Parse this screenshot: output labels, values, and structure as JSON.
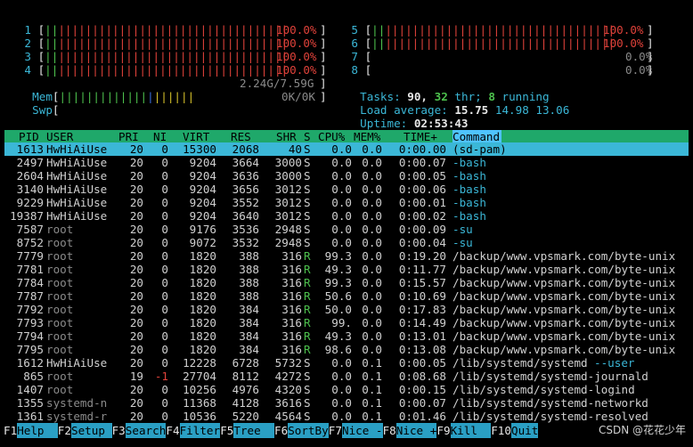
{
  "cpus_left": [
    {
      "num": "1",
      "bar_green": "||",
      "bar_red": "||||||||||||||||||||||||||||||||||",
      "pct": "100.0%"
    },
    {
      "num": "2",
      "bar_green": "||",
      "bar_red": "||||||||||||||||||||||||||||||||||",
      "pct": "100.0%"
    },
    {
      "num": "3",
      "bar_green": "||",
      "bar_red": "||||||||||||||||||||||||||||||||||",
      "pct": "100.0%"
    },
    {
      "num": "4",
      "bar_green": "||",
      "bar_red": "||||||||||||||||||||||||||||||||||",
      "pct": "100.0%"
    }
  ],
  "cpus_right": [
    {
      "num": "5",
      "bar_green": "||",
      "bar_red": "||||||||||||||||||||||||||||||||||",
      "pct": "100.0%"
    },
    {
      "num": "6",
      "bar_green": "||",
      "bar_red": "||||||||||||||||||||||||||||||||||",
      "pct": "100.0%"
    },
    {
      "num": "7",
      "bar_green": "",
      "bar_red": "",
      "pct": "0.0%"
    },
    {
      "num": "8",
      "bar_green": "",
      "bar_red": "",
      "pct": "0.0%"
    }
  ],
  "mem": {
    "label": "Mem",
    "bar_green": "|||||||||||||",
    "bar_blue": "|",
    "bar_yellow": "||||||",
    "value": "2.24G/7.59G"
  },
  "swp": {
    "label": "Swp",
    "value": "0K/0K"
  },
  "tasks": {
    "label": "Tasks:",
    "count": "90,",
    "thr": "32",
    "thr_label": "thr;",
    "running": "8",
    "running_label": "running"
  },
  "load": {
    "label": "Load average:",
    "l1": "15.75",
    "l5": "14.98",
    "l15": "13.06"
  },
  "uptime": {
    "label": "Uptime:",
    "value": "02:53:43"
  },
  "columns": {
    "pid": "PID",
    "user": "USER",
    "pri": "PRI",
    "ni": "NI",
    "virt": "VIRT",
    "res": "RES",
    "shr": "SHR",
    "s": "S",
    "cpu": "CPU%",
    "mem": "MEM%",
    "time": "TIME+",
    "command": "Command"
  },
  "processes": [
    {
      "pid": "1613",
      "user": "HwHiAiUse",
      "pri": "20",
      "ni": "0",
      "virt": "15300",
      "res": "2068",
      "shr": "40",
      "s": "S",
      "cpu": "0.0",
      "mem": "0.0",
      "time": "0:00.00",
      "command": "(sd-pam)",
      "selected": true
    },
    {
      "pid": "2497",
      "user": "HwHiAiUse",
      "pri": "20",
      "ni": "0",
      "virt": "9204",
      "res": "3664",
      "shr": "3000",
      "s": "S",
      "cpu": "0.0",
      "mem": "0.0",
      "time": "0:00.07",
      "command": "-bash"
    },
    {
      "pid": "2604",
      "user": "HwHiAiUse",
      "pri": "20",
      "ni": "0",
      "virt": "9204",
      "res": "3636",
      "shr": "3000",
      "s": "S",
      "cpu": "0.0",
      "mem": "0.0",
      "time": "0:00.05",
      "command": "-bash"
    },
    {
      "pid": "3140",
      "user": "HwHiAiUse",
      "pri": "20",
      "ni": "0",
      "virt": "9204",
      "res": "3656",
      "shr": "3012",
      "s": "S",
      "cpu": "0.0",
      "mem": "0.0",
      "time": "0:00.06",
      "command": "-bash"
    },
    {
      "pid": "9229",
      "user": "HwHiAiUse",
      "pri": "20",
      "ni": "0",
      "virt": "9204",
      "res": "3552",
      "shr": "3012",
      "s": "S",
      "cpu": "0.0",
      "mem": "0.0",
      "time": "0:00.01",
      "command": "-bash"
    },
    {
      "pid": "19387",
      "user": "HwHiAiUse",
      "pri": "20",
      "ni": "0",
      "virt": "9204",
      "res": "3640",
      "shr": "3012",
      "s": "S",
      "cpu": "0.0",
      "mem": "0.0",
      "time": "0:00.02",
      "command": "-bash"
    },
    {
      "pid": "7587",
      "user": "root",
      "pri": "20",
      "ni": "0",
      "virt": "9176",
      "res": "3536",
      "shr": "2948",
      "s": "S",
      "cpu": "0.0",
      "mem": "0.0",
      "time": "0:00.09",
      "command": "-su"
    },
    {
      "pid": "8752",
      "user": "root",
      "pri": "20",
      "ni": "0",
      "virt": "9072",
      "res": "3532",
      "shr": "2948",
      "s": "S",
      "cpu": "0.0",
      "mem": "0.0",
      "time": "0:00.04",
      "command": "-su"
    },
    {
      "pid": "7779",
      "user": "root",
      "pri": "20",
      "ni": "0",
      "virt": "1820",
      "res": "388",
      "shr": "316",
      "s": "R",
      "cpu": "99.3",
      "mem": "0.0",
      "time": "0:19.20",
      "command": "/backup/www.vpsmark.com/byte-unix"
    },
    {
      "pid": "7781",
      "user": "root",
      "pri": "20",
      "ni": "0",
      "virt": "1820",
      "res": "388",
      "shr": "316",
      "s": "R",
      "cpu": "49.3",
      "mem": "0.0",
      "time": "0:11.77",
      "command": "/backup/www.vpsmark.com/byte-unix"
    },
    {
      "pid": "7784",
      "user": "root",
      "pri": "20",
      "ni": "0",
      "virt": "1820",
      "res": "388",
      "shr": "316",
      "s": "R",
      "cpu": "99.3",
      "mem": "0.0",
      "time": "0:15.57",
      "command": "/backup/www.vpsmark.com/byte-unix"
    },
    {
      "pid": "7787",
      "user": "root",
      "pri": "20",
      "ni": "0",
      "virt": "1820",
      "res": "388",
      "shr": "316",
      "s": "R",
      "cpu": "50.6",
      "mem": "0.0",
      "time": "0:10.69",
      "command": "/backup/www.vpsmark.com/byte-unix"
    },
    {
      "pid": "7792",
      "user": "root",
      "pri": "20",
      "ni": "0",
      "virt": "1820",
      "res": "384",
      "shr": "316",
      "s": "R",
      "cpu": "50.0",
      "mem": "0.0",
      "time": "0:17.83",
      "command": "/backup/www.vpsmark.com/byte-unix"
    },
    {
      "pid": "7793",
      "user": "root",
      "pri": "20",
      "ni": "0",
      "virt": "1820",
      "res": "384",
      "shr": "316",
      "s": "R",
      "cpu": "99.",
      "mem": "0.0",
      "time": "0:14.49",
      "command": "/backup/www.vpsmark.com/byte-unix"
    },
    {
      "pid": "7794",
      "user": "root",
      "pri": "20",
      "ni": "0",
      "virt": "1820",
      "res": "384",
      "shr": "316",
      "s": "R",
      "cpu": "49.3",
      "mem": "0.0",
      "time": "0:13.01",
      "command": "/backup/www.vpsmark.com/byte-unix"
    },
    {
      "pid": "7795",
      "user": "root",
      "pri": "20",
      "ni": "0",
      "virt": "1820",
      "res": "384",
      "shr": "316",
      "s": "R",
      "cpu": "98.6",
      "mem": "0.0",
      "time": "0:13.08",
      "command": "/backup/www.vpsmark.com/byte-unix"
    },
    {
      "pid": "1612",
      "user": "HwHiAiUse",
      "pri": "20",
      "ni": "0",
      "virt": "12228",
      "res": "6728",
      "shr": "5732",
      "s": "S",
      "cpu": "0.0",
      "mem": "0.1",
      "time": "0:00.05",
      "command": "/lib/systemd/systemd",
      "arg": "--user"
    },
    {
      "pid": "865",
      "user": "root",
      "pri": "19",
      "ni": "-1",
      "virt": "27704",
      "res": "8112",
      "shr": "4272",
      "s": "S",
      "cpu": "0.0",
      "mem": "0.1",
      "time": "0:08.68",
      "command": "/lib/systemd/systemd-journald"
    },
    {
      "pid": "1407",
      "user": "root",
      "pri": "20",
      "ni": "0",
      "virt": "10256",
      "res": "4976",
      "shr": "4320",
      "s": "S",
      "cpu": "0.0",
      "mem": "0.1",
      "time": "0:00.15",
      "command": "/lib/systemd/systemd-logind"
    },
    {
      "pid": "1355",
      "user": "systemd-n",
      "pri": "20",
      "ni": "0",
      "virt": "11368",
      "res": "4128",
      "shr": "3616",
      "s": "S",
      "cpu": "0.0",
      "mem": "0.1",
      "time": "0:00.07",
      "command": "/lib/systemd/systemd-networkd"
    },
    {
      "pid": "1361",
      "user": "systemd-r",
      "pri": "20",
      "ni": "0",
      "virt": "10536",
      "res": "5220",
      "shr": "4564",
      "s": "S",
      "cpu": "0.0",
      "mem": "0.1",
      "time": "0:01.46",
      "command": "/lib/systemd/systemd-resolved"
    }
  ],
  "footer": [
    {
      "key": "F1",
      "label": "Help  "
    },
    {
      "key": "F2",
      "label": "Setup "
    },
    {
      "key": "F3",
      "label": "Search"
    },
    {
      "key": "F4",
      "label": "Filter"
    },
    {
      "key": "F5",
      "label": "Tree  "
    },
    {
      "key": "F6",
      "label": "SortBy"
    },
    {
      "key": "F7",
      "label": "Nice -"
    },
    {
      "key": "F8",
      "label": "Nice +"
    },
    {
      "key": "F9",
      "label": "Kill  "
    },
    {
      "key": "F10",
      "label": "Quit"
    }
  ],
  "watermark": "CSDN @花花少年"
}
